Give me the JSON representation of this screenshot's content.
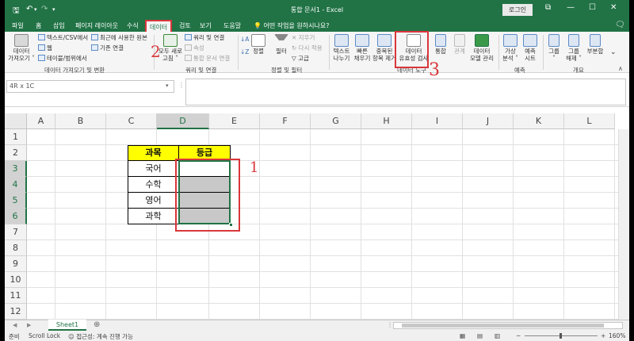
{
  "window": {
    "title": "통합 문서1 - Excel",
    "login_label": "로그인",
    "controls": {
      "restore": "⧉",
      "minimize": "—",
      "maximize": "☐",
      "close": "✕"
    }
  },
  "quick_access": {
    "save_icon": "save-icon",
    "undo_icon": "undo-icon",
    "redo_icon": "redo-icon",
    "customize_icon": "customize-icon"
  },
  "tabs": [
    "파일",
    "홈",
    "삽입",
    "페이지 레이아웃",
    "수식",
    "데이터",
    "검토",
    "보기",
    "도움말"
  ],
  "active_tab": "데이터",
  "search_hint": "어떤 작업을 원하시나요?",
  "ribbon": {
    "get_data": {
      "big_button": [
        "데이터",
        "가져오기 ˅"
      ],
      "small": [
        "텍스트/CSV에서",
        "웹",
        "테이블/범위에서"
      ],
      "recent": [
        "최근에 사용한 원본",
        "기존 연결"
      ],
      "group_label": "데이터 가져오기 및 변환"
    },
    "queries": {
      "big_button": [
        "모두 새로",
        "고침 ˅"
      ],
      "small": [
        "쿼리 및 연결",
        "속성",
        "통합 문서 연결"
      ],
      "group_label": "쿼리 및 연결"
    },
    "sort_filter": {
      "sort_small": [
        "↓A",
        "↓Z"
      ],
      "sort": "정렬",
      "filter": "필터",
      "small": [
        "지우기",
        "다시 적용",
        "고급"
      ],
      "group_label": "정렬 및 필터"
    },
    "data_tools": {
      "buttons": [
        [
          "텍스트",
          "나누기"
        ],
        [
          "빠른",
          "채우기"
        ],
        [
          "중복된",
          "항목 제거"
        ],
        [
          "데이터",
          "유효성 검사"
        ]
      ],
      "small": [
        "통합",
        "관계",
        "데이터",
        "모델 관리"
      ],
      "group_label": "데이터 도구"
    },
    "forecast": {
      "buttons": [
        [
          "가상",
          "분석 ˅"
        ],
        [
          "예측",
          "시트"
        ]
      ],
      "group_label": "예측"
    },
    "outline": {
      "buttons": [
        [
          "그룹",
          "˅"
        ],
        [
          "그룹",
          "해제 ˅"
        ],
        [
          "부분합",
          ""
        ]
      ],
      "group_label": "개요"
    }
  },
  "formula_bar": {
    "name_box": "4R x 1C",
    "formula": ""
  },
  "grid": {
    "columns": [
      "A",
      "B",
      "C",
      "D",
      "E",
      "F",
      "G",
      "H",
      "I",
      "J",
      "K",
      "L"
    ],
    "rows": [
      "1",
      "2",
      "3",
      "4",
      "5",
      "6",
      "7",
      "8",
      "9",
      "10",
      "11",
      "12"
    ],
    "table": {
      "header": [
        "과목",
        "등급"
      ],
      "subjects": [
        "국어",
        "수학",
        "영어",
        "과학"
      ]
    }
  },
  "annotations": {
    "one": "1",
    "two": "2",
    "three": "3"
  },
  "sheets": {
    "active": "Sheet1",
    "add": "⊕"
  },
  "status": {
    "ready": "준비",
    "scroll_lock": "Scroll Lock",
    "accessibility": "접근성: 계속 진행 가능",
    "zoom": "160%"
  }
}
